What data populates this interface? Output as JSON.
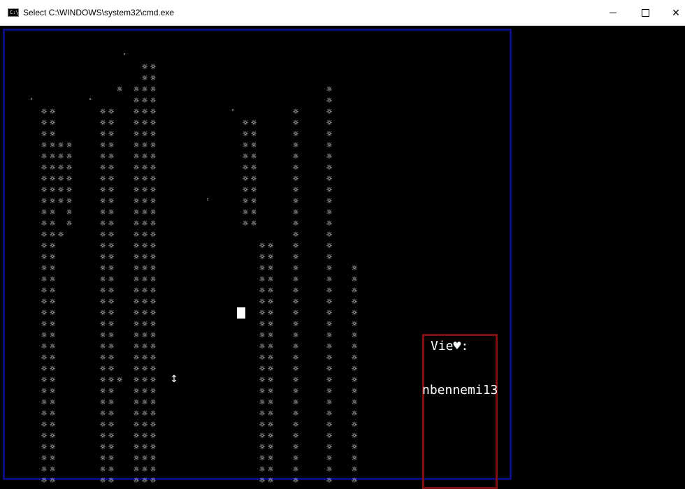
{
  "window": {
    "title": "Select C:\\WINDOWS\\system32\\cmd.exe",
    "app_icon": "cmd-icon",
    "app_icon_glyph": "C:\\",
    "controls": {
      "minimize": "minimize-icon",
      "maximize": "maximize-icon",
      "close": "close-icon",
      "close_glyph": "✕"
    }
  },
  "game": {
    "tile_glyph": "☼",
    "small_glyph": "²",
    "player_marker": "█",
    "item_glyph": "↕",
    "status": {
      "life_label": "Vie♥:",
      "player_name": "nbennemi13"
    },
    "colors": {
      "background": "#000000",
      "frame_border": "#0b0b82",
      "panel_border": "#7f0f10",
      "foreground": "#ffffff"
    }
  }
}
